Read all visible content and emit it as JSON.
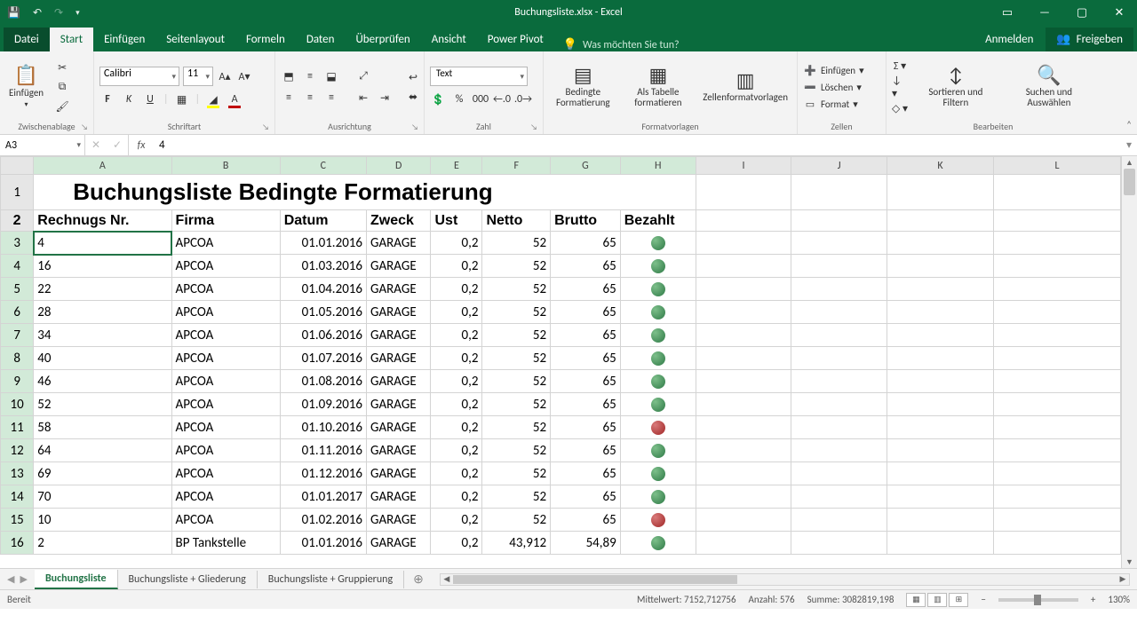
{
  "titlebar": {
    "title": "Buchungsliste.xlsx - Excel"
  },
  "ribbon": {
    "tabs": {
      "file": "Datei",
      "start": "Start",
      "einfuegen": "Einfügen",
      "seitenlayout": "Seitenlayout",
      "formeln": "Formeln",
      "daten": "Daten",
      "ueberpruefen": "Überprüfen",
      "ansicht": "Ansicht",
      "powerpivot": "Power Pivot"
    },
    "tellme": "Was möchten Sie tun?",
    "login": "Anmelden",
    "share": "Freigeben",
    "groups": {
      "clipboard": "Zwischenablage",
      "font": "Schriftart",
      "align": "Ausrichtung",
      "number": "Zahl",
      "styles": "Formatvorlagen",
      "cells": "Zellen",
      "editing": "Bearbeiten"
    },
    "paste": "Einfügen",
    "font_name": "Calibri",
    "font_size": "11",
    "number_format": "Text",
    "cond_fmt": "Bedingte Formatierung",
    "as_table": "Als Tabelle formatieren",
    "cell_styles": "Zellenformatvorlagen",
    "insert": "Einfügen",
    "delete": "Löschen",
    "format": "Format",
    "sort_filter": "Sortieren und Filtern",
    "find_select": "Suchen und Auswählen"
  },
  "fx": {
    "name_box": "A3",
    "formula": "4"
  },
  "columns": [
    "A",
    "B",
    "C",
    "D",
    "E",
    "F",
    "G",
    "H",
    "I",
    "J",
    "K",
    "L"
  ],
  "title_cell": "Buchungsliste Bedingte Formatierung",
  "headers": [
    "Rechnugs Nr.",
    "Firma",
    "Datum",
    "Zweck",
    "Ust",
    "Netto",
    "Brutto",
    "Bezahlt"
  ],
  "rows": [
    {
      "n": 3,
      "nr": "4",
      "firma": "APCOA",
      "datum": "01.01.2016",
      "zweck": "GARAGE",
      "ust": "0,2",
      "netto": "52",
      "brutto": "65",
      "paid": "green"
    },
    {
      "n": 4,
      "nr": "16",
      "firma": "APCOA",
      "datum": "01.03.2016",
      "zweck": "GARAGE",
      "ust": "0,2",
      "netto": "52",
      "brutto": "65",
      "paid": "green"
    },
    {
      "n": 5,
      "nr": "22",
      "firma": "APCOA",
      "datum": "01.04.2016",
      "zweck": "GARAGE",
      "ust": "0,2",
      "netto": "52",
      "brutto": "65",
      "paid": "green"
    },
    {
      "n": 6,
      "nr": "28",
      "firma": "APCOA",
      "datum": "01.05.2016",
      "zweck": "GARAGE",
      "ust": "0,2",
      "netto": "52",
      "brutto": "65",
      "paid": "green"
    },
    {
      "n": 7,
      "nr": "34",
      "firma": "APCOA",
      "datum": "01.06.2016",
      "zweck": "GARAGE",
      "ust": "0,2",
      "netto": "52",
      "brutto": "65",
      "paid": "green"
    },
    {
      "n": 8,
      "nr": "40",
      "firma": "APCOA",
      "datum": "01.07.2016",
      "zweck": "GARAGE",
      "ust": "0,2",
      "netto": "52",
      "brutto": "65",
      "paid": "green"
    },
    {
      "n": 9,
      "nr": "46",
      "firma": "APCOA",
      "datum": "01.08.2016",
      "zweck": "GARAGE",
      "ust": "0,2",
      "netto": "52",
      "brutto": "65",
      "paid": "green"
    },
    {
      "n": 10,
      "nr": "52",
      "firma": "APCOA",
      "datum": "01.09.2016",
      "zweck": "GARAGE",
      "ust": "0,2",
      "netto": "52",
      "brutto": "65",
      "paid": "green"
    },
    {
      "n": 11,
      "nr": "58",
      "firma": "APCOA",
      "datum": "01.10.2016",
      "zweck": "GARAGE",
      "ust": "0,2",
      "netto": "52",
      "brutto": "65",
      "paid": "red"
    },
    {
      "n": 12,
      "nr": "64",
      "firma": "APCOA",
      "datum": "01.11.2016",
      "zweck": "GARAGE",
      "ust": "0,2",
      "netto": "52",
      "brutto": "65",
      "paid": "green"
    },
    {
      "n": 13,
      "nr": "69",
      "firma": "APCOA",
      "datum": "01.12.2016",
      "zweck": "GARAGE",
      "ust": "0,2",
      "netto": "52",
      "brutto": "65",
      "paid": "green"
    },
    {
      "n": 14,
      "nr": "70",
      "firma": "APCOA",
      "datum": "01.01.2017",
      "zweck": "GARAGE",
      "ust": "0,2",
      "netto": "52",
      "brutto": "65",
      "paid": "green"
    },
    {
      "n": 15,
      "nr": "10",
      "firma": "APCOA",
      "datum": "01.02.2016",
      "zweck": "GARAGE",
      "ust": "0,2",
      "netto": "52",
      "brutto": "65",
      "paid": "red"
    },
    {
      "n": 16,
      "nr": "2",
      "firma": "BP Tankstelle",
      "datum": "01.01.2016",
      "zweck": "GARAGE",
      "ust": "0,2",
      "netto": "43,912",
      "brutto": "54,89",
      "paid": "green"
    }
  ],
  "sheet_tabs": {
    "s1": "Buchungsliste",
    "s2": "Buchungsliste + Gliederung",
    "s3": "Buchungsliste + Gruppierung"
  },
  "status": {
    "ready": "Bereit",
    "avg_lbl": "Mittelwert:",
    "avg": "7152,712756",
    "count_lbl": "Anzahl:",
    "count": "576",
    "sum_lbl": "Summe:",
    "sum": "3082819,198",
    "zoom": "130%"
  }
}
